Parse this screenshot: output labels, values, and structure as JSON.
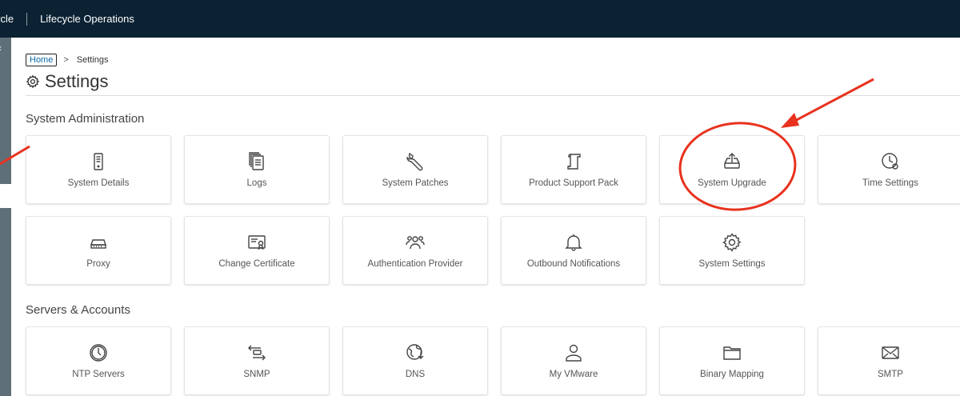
{
  "topbar": {
    "app_name": "ycle",
    "section_name": "Lifecycle Operations"
  },
  "breadcrumb": {
    "home": "Home",
    "separator": ">",
    "current": "Settings"
  },
  "page": {
    "title": "Settings"
  },
  "sections": {
    "admin": {
      "heading": "System Administration",
      "tiles": [
        {
          "label": "System Details",
          "icon": "server-icon"
        },
        {
          "label": "Logs",
          "icon": "logs-icon"
        },
        {
          "label": "System Patches",
          "icon": "wrench-icon"
        },
        {
          "label": "Product Support Pack",
          "icon": "scroll-icon"
        },
        {
          "label": "System Upgrade",
          "icon": "upload-tray-icon"
        },
        {
          "label": "Time Settings",
          "icon": "clock-gear-icon"
        },
        {
          "label": "Proxy",
          "icon": "network-switch-icon"
        },
        {
          "label": "Change Certificate",
          "icon": "certificate-icon"
        },
        {
          "label": "Authentication Provider",
          "icon": "users-icon"
        },
        {
          "label": "Outbound Notifications",
          "icon": "bell-icon"
        },
        {
          "label": "System Settings",
          "icon": "gear-icon"
        }
      ]
    },
    "servers": {
      "heading": "Servers & Accounts",
      "tiles": [
        {
          "label": "NTP Servers",
          "icon": "clock-icon"
        },
        {
          "label": "SNMP",
          "icon": "arrows-exchange-icon"
        },
        {
          "label": "DNS",
          "icon": "globe-icon"
        },
        {
          "label": "My VMware",
          "icon": "user-icon"
        },
        {
          "label": "Binary Mapping",
          "icon": "folder-icon"
        },
        {
          "label": "SMTP",
          "icon": "envelope-icon"
        }
      ]
    }
  },
  "colors": {
    "topbar": "#0b2233",
    "sidebar": "#5f6f78",
    "annotation": "#e8321e",
    "link": "#0b6aa7"
  }
}
